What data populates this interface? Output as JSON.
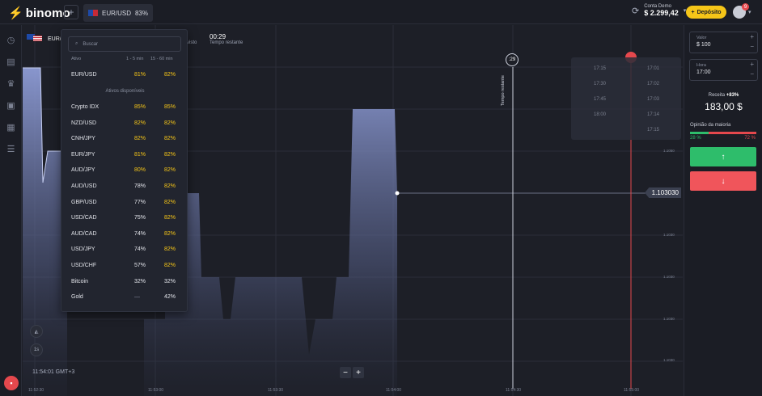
{
  "topbar": {
    "logo_text": "binomo",
    "add_tab": "+",
    "asset_tab": {
      "symbol": "EUR/USD",
      "payout": "83%"
    },
    "account": {
      "label": "Conta Demo",
      "balance": "$ 2.299,42"
    },
    "deposit_label": "Depósito",
    "notifications": "9"
  },
  "chart": {
    "symbol": "EUR/",
    "prev_label_fragment": "visto",
    "timer": {
      "value": "00:29",
      "label": "Tempo restante"
    },
    "countdown_circle": ":29",
    "vertical_label": "Tempo restante",
    "current_price": "1.103030",
    "clock": "11:54:01 GMT+3",
    "timeframe": "1s",
    "zoom_out": "−",
    "zoom_in": "+",
    "y_ticks": [
      "1.1050",
      "1.1030",
      "1.1030",
      "1.1030",
      "1.1030"
    ],
    "x_ticks": [
      "11:52:30",
      "11:53:00",
      "11:53:30",
      "11:54:00",
      "11:54:30",
      "11:55:00"
    ],
    "time_slots_left": [
      "17:15",
      "17:30",
      "17:45",
      "18:00"
    ],
    "time_slots_right": [
      "17:01",
      "17:02",
      "17:03",
      "17:14",
      "17:15"
    ]
  },
  "asset_dropdown": {
    "search_placeholder": "Buscar",
    "headers": {
      "asset": "Ativo",
      "short": "1 - 5 min",
      "long": "15 - 60 min"
    },
    "favorite": {
      "name": "EUR/USD",
      "short": "81%",
      "long": "82%"
    },
    "section_title": "Ativos disponíveis",
    "assets": [
      {
        "name": "Crypto IDX",
        "short": "85%",
        "long": "85%"
      },
      {
        "name": "NZD/USD",
        "short": "82%",
        "long": "82%"
      },
      {
        "name": "CNH/JPY",
        "short": "82%",
        "long": "82%"
      },
      {
        "name": "EUR/JPY",
        "short": "81%",
        "long": "82%"
      },
      {
        "name": "AUD/JPY",
        "short": "80%",
        "long": "82%"
      },
      {
        "name": "AUD/USD",
        "short": "78%",
        "long": "82%"
      },
      {
        "name": "GBP/USD",
        "short": "77%",
        "long": "82%"
      },
      {
        "name": "USD/CAD",
        "short": "75%",
        "long": "82%"
      },
      {
        "name": "AUD/CAD",
        "short": "74%",
        "long": "82%"
      },
      {
        "name": "USD/JPY",
        "short": "74%",
        "long": "82%"
      },
      {
        "name": "USD/CHF",
        "short": "57%",
        "long": "82%"
      },
      {
        "name": "Bitcoin",
        "short": "32%",
        "long": "32%"
      },
      {
        "name": "Gold",
        "short": "—",
        "long": "42%"
      }
    ]
  },
  "right_panel": {
    "value_label": "Valor",
    "value": "$ 100",
    "time_label": "Hora",
    "time": "17:00",
    "receipt_label": "Receita",
    "receipt_pct": "+83%",
    "receipt_amount": "183,00 $",
    "opinion_label": "Opinião da maioria",
    "opinion_up": "28 %",
    "opinion_down": "72 %",
    "opinion_up_fraction": 0.28
  },
  "colors": {
    "accent": "#f5c518",
    "up": "#2ebd6b",
    "down": "#f0555b"
  }
}
